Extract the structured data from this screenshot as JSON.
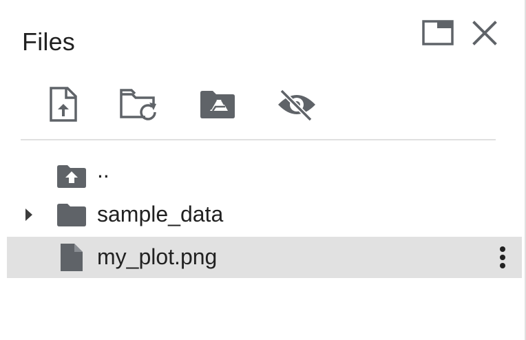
{
  "panel": {
    "title": "Files"
  },
  "header_buttons": {
    "popout_icon": "popout-window-icon",
    "close_icon": "close-icon"
  },
  "toolbar": {
    "items": [
      {
        "icon": "upload-file-icon"
      },
      {
        "icon": "folder-refresh-icon"
      },
      {
        "icon": "mount-drive-icon"
      },
      {
        "icon": "hidden-files-icon"
      }
    ]
  },
  "tree": {
    "parent": {
      "label": "..",
      "icon": "folder-up-icon"
    },
    "items": [
      {
        "label": "sample_data",
        "type": "folder",
        "icon": "folder-icon",
        "expandable": true
      },
      {
        "label": "my_plot.png",
        "type": "file",
        "icon": "file-icon",
        "selected": true,
        "menu_icon": "more-vert-icon"
      }
    ]
  },
  "colors": {
    "icon": "#5f6368",
    "selected_row": "#e1e1e1",
    "divider": "#e0e0e0",
    "text": "#212121"
  }
}
